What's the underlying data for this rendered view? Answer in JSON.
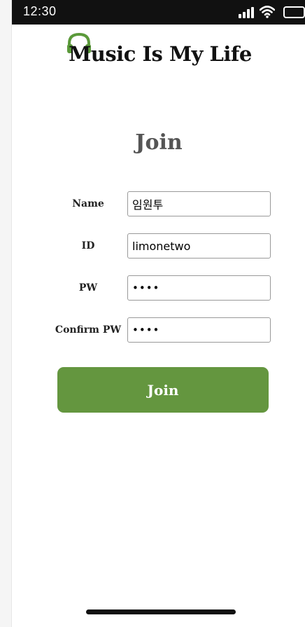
{
  "status_bar": {
    "time": "12:30",
    "icons": [
      "signal-icon",
      "wifi-icon",
      "battery-icon"
    ]
  },
  "logo": {
    "text": "Music Is My Life",
    "icon": "headphones-icon",
    "icon_color": "#5b9a3a"
  },
  "page": {
    "title": "Join"
  },
  "form": {
    "name": {
      "label": "Name",
      "value": "임원투"
    },
    "id": {
      "label": "ID",
      "value": "limonetwo"
    },
    "pw": {
      "label": "PW",
      "value": "••••"
    },
    "confirm_pw": {
      "label": "Confirm PW",
      "value": "••••"
    }
  },
  "join_button": {
    "label": "Join",
    "color": "#64963f"
  }
}
